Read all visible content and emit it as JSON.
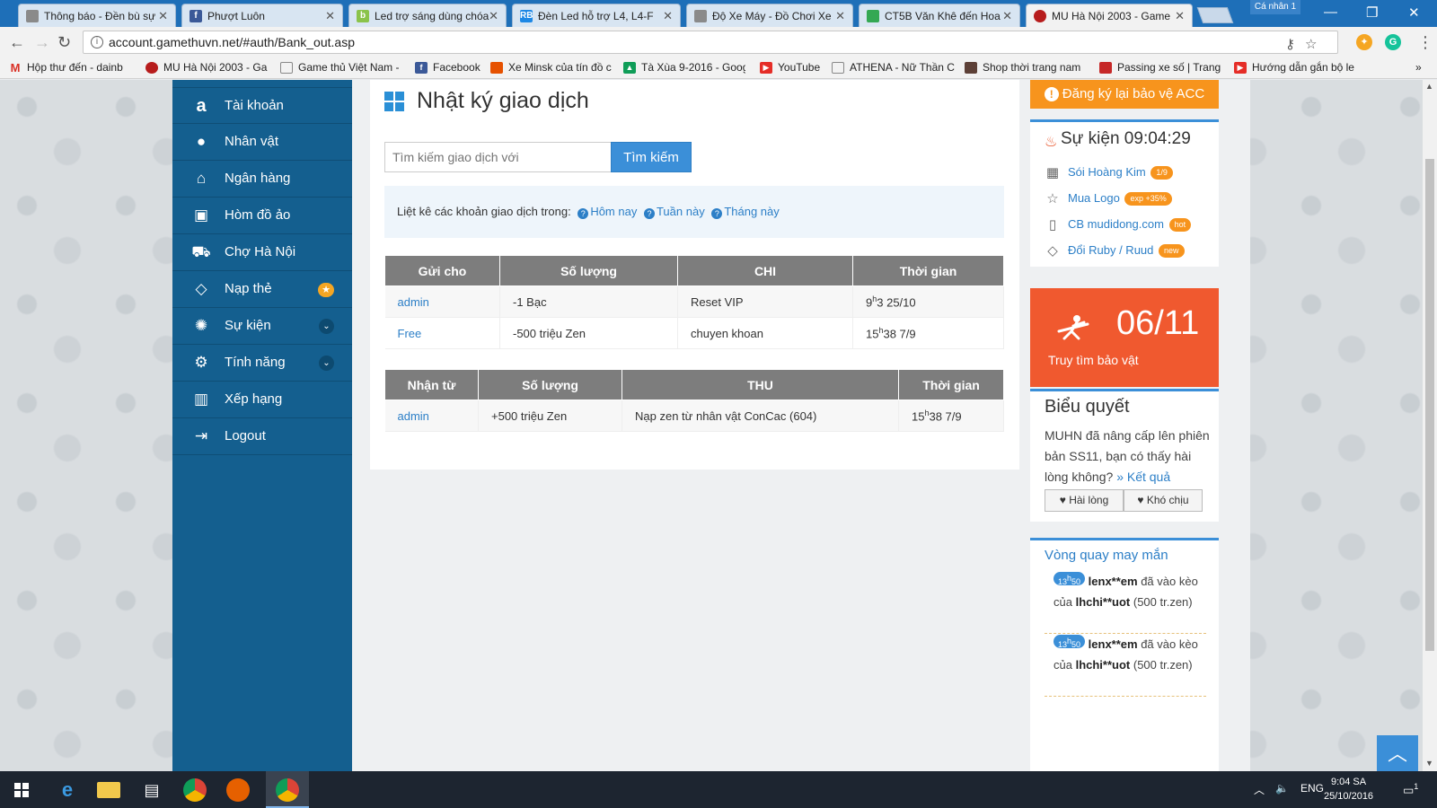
{
  "browser": {
    "tabs": [
      {
        "label": "Thông báo - Đền bù sự",
        "icon": "doc-icon",
        "color": "#8a8a8a"
      },
      {
        "label": "Phượt Luôn",
        "icon": "facebook-icon",
        "color": "#3b5998"
      },
      {
        "label": "Led trợ sáng dùng chóa",
        "icon": "leaf-icon",
        "color": "#8bc34a"
      },
      {
        "label": "Đèn Led hỗ trợ L4, L4-F",
        "icon": "rb-icon",
        "color": "#1e88e5"
      },
      {
        "label": "Độ Xe Máy - Đồ Chơi Xe",
        "icon": "doc-icon",
        "color": "#8a8a8a"
      },
      {
        "label": "CT5B Văn Khê đến Hoa",
        "icon": "maps-icon",
        "color": "#34a853"
      },
      {
        "label": "MU Hà Nội 2003 - Game",
        "icon": "mu-icon",
        "color": "#b71c1c"
      }
    ],
    "profile_label": "Cá nhân 1",
    "url": "account.gamethuvn.net/#auth/Bank_out.asp",
    "bookmarks": [
      {
        "label": "Hộp thư đến - dainb",
        "icon": "gmail-icon",
        "color": "#d93025"
      },
      {
        "label": "MU Hà Nội 2003 - Ga",
        "icon": "mu-icon",
        "color": "#b71c1c"
      },
      {
        "label": "Game thủ Việt Nam -",
        "icon": "doc-icon",
        "color": "#8a8a8a"
      },
      {
        "label": "Facebook",
        "icon": "facebook-icon",
        "color": "#3b5998"
      },
      {
        "label": "Xe Minsk của tín đồ c",
        "icon": "minsk-icon",
        "color": "#e65100"
      },
      {
        "label": "Tà Xùa 9-2016 - Goog",
        "icon": "drive-icon",
        "color": "#0f9d58"
      },
      {
        "label": "YouTube",
        "icon": "youtube-icon",
        "color": "#e52d27"
      },
      {
        "label": "ATHENA - Nữ Thần C",
        "icon": "doc-icon",
        "color": "#8a8a8a"
      },
      {
        "label": "Shop thời trang nam",
        "icon": "shop-icon",
        "color": "#5d4037"
      },
      {
        "label": "Passing xe số | Trang",
        "icon": "passing-icon",
        "color": "#c62828"
      },
      {
        "label": "Hướng dẫn gắn bộ le",
        "icon": "youtube-icon",
        "color": "#e52d27"
      }
    ]
  },
  "sidebar": {
    "items": [
      {
        "label": "Tài khoản",
        "icon": "amazon-icon",
        "glyph": "a"
      },
      {
        "label": "Nhân vật",
        "icon": "user-icon",
        "glyph": "👤"
      },
      {
        "label": "Ngân hàng",
        "icon": "bank-icon",
        "glyph": "🏛"
      },
      {
        "label": "Hòm đồ ảo",
        "icon": "briefcase-icon",
        "glyph": "💼"
      },
      {
        "label": "Chợ Hà Nội",
        "icon": "cart-icon",
        "glyph": "🛒"
      },
      {
        "label": "Nạp thẻ",
        "icon": "diamond-icon",
        "glyph": "◇",
        "badge": "★"
      },
      {
        "label": "Sự kiện",
        "icon": "android-icon",
        "glyph": "🤖",
        "dropdown": "⌄"
      },
      {
        "label": "Tính năng",
        "icon": "gears-icon",
        "glyph": "⚙",
        "dropdown": "⌄"
      },
      {
        "label": "Xếp hạng",
        "icon": "bar-chart-icon",
        "glyph": "📊"
      },
      {
        "label": "Logout",
        "icon": "logout-icon",
        "glyph": "⇥"
      }
    ]
  },
  "main": {
    "title": "Nhật ký giao dịch",
    "search_placeholder": "Tìm kiếm giao dịch với",
    "search_button": "Tìm kiếm",
    "filter_prefix": "Liệt kê các khoản giao dịch trong:",
    "filter_links": [
      "Hôm nay",
      "Tuần này",
      "Tháng này"
    ],
    "sent_table": {
      "headers": [
        "Gửi cho",
        "Số lượng",
        "CHI",
        "Thời gian"
      ],
      "rows": [
        {
          "to": "admin",
          "amount": "-1  Bạc",
          "note": "Reset VIP",
          "time_h": "9",
          "time_rest": "3 25/10"
        },
        {
          "to": "Free",
          "amount": "-500  triệu Zen",
          "note": "chuyen khoan",
          "time_h": "15",
          "time_rest": "38 7/9"
        }
      ]
    },
    "received_table": {
      "headers": [
        "Nhận từ",
        "Số lượng",
        "THU",
        "Thời gian"
      ],
      "rows": [
        {
          "from": "admin",
          "amount": "+500  triệu Zen",
          "note": "Nạp zen từ nhân vật ConCac (604)",
          "time_h": "15",
          "time_rest": "38 7/9"
        }
      ]
    },
    "time_sup": "h"
  },
  "right": {
    "acc_button": "Đăng ký lại bảo vệ ACC",
    "event_title": "Sự kiện 09:04:29",
    "events": [
      {
        "label": "Sói Hoàng Kim",
        "badge": "1/9",
        "icon": "gift-icon",
        "glyph": "🎁"
      },
      {
        "label": "Mua Logo",
        "badge": "exp +35%",
        "icon": "star-icon",
        "glyph": "☆"
      },
      {
        "label": "CB mudidong.com",
        "badge": "hot",
        "icon": "mobile-icon",
        "glyph": "▯"
      },
      {
        "label": "Đổi Ruby / Ruud",
        "badge": "new",
        "icon": "diamond-icon",
        "glyph": "◇"
      }
    ],
    "treasure_date": "06/11",
    "treasure_label": "Truy tìm bảo vật",
    "poll_title": "Biểu quyết",
    "poll_text": "MUHN đã nâng cấp lên phiên bản SS11, bạn có thấy hài lòng không?",
    "poll_link": "» Kết quả",
    "poll_yes": "♥ Hài lòng",
    "poll_no": "♥ Khó chịu",
    "lucky_title": "Vòng quay may mắn",
    "lucky_items": [
      {
        "time_h": "13",
        "time_m": "50",
        "user": "lenx**em",
        "mid": " đã vào kèo của ",
        "target": "lhchi**uot",
        "tail": " (500 tr.zen)"
      },
      {
        "time_h": "13",
        "time_m": "50",
        "user": "lenx**em",
        "mid": " đã vào kèo của ",
        "target": "lhchi**uot",
        "tail": " (500 tr.zen)"
      }
    ]
  },
  "taskbar": {
    "lang": "ENG",
    "time": "9:04 SA",
    "date": "25/10/2016",
    "notif_count": "1"
  },
  "colors": {
    "sidebar": "#145f8f",
    "accent_blue": "#3b8fd8",
    "accent_orange": "#f7941d",
    "treasure": "#f0592f",
    "table_header": "#7d7d7d"
  }
}
